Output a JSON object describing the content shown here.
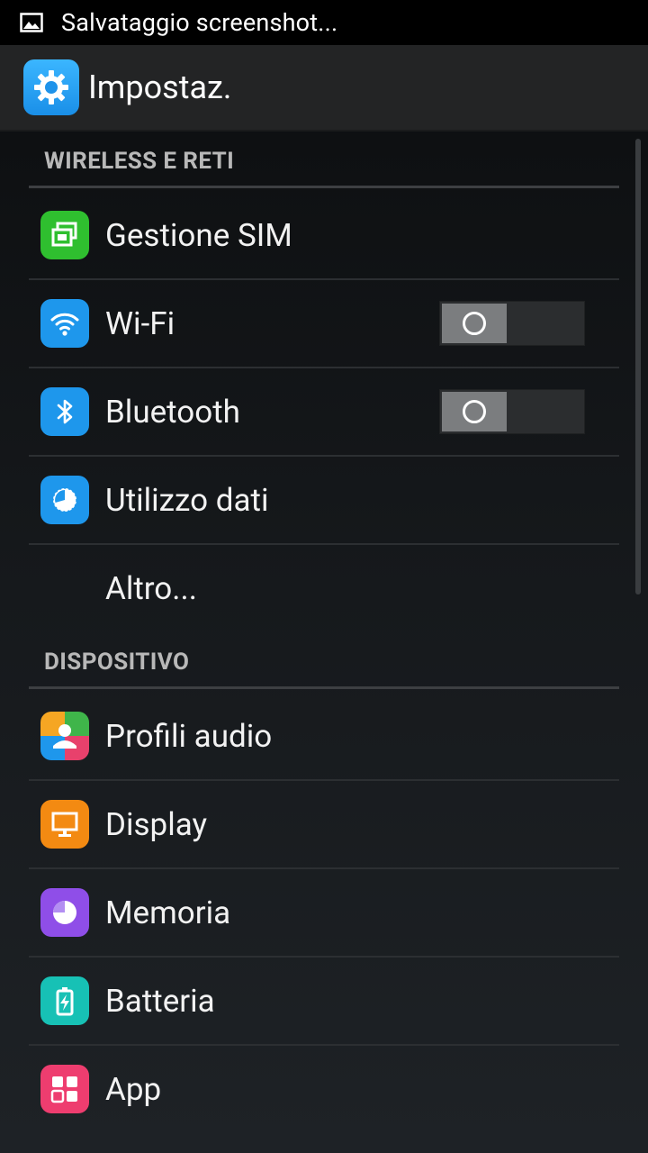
{
  "status_bar": {
    "notification_icon": "screenshot-image-icon",
    "text": "Salvataggio screenshot..."
  },
  "action_bar": {
    "app_icon": "settings-gear-icon",
    "title": "Impostaz."
  },
  "sections": [
    {
      "header": "WIRELESS E RETI",
      "items": [
        {
          "label": "Gestione SIM",
          "icon": "sim-card-icon",
          "icon_color": "#2fbf2f"
        },
        {
          "label": "Wi-Fi",
          "icon": "wifi-icon",
          "icon_color": "#1e97ec",
          "toggle": "off"
        },
        {
          "label": "Bluetooth",
          "icon": "bluetooth-icon",
          "icon_color": "#1e97ec",
          "toggle": "off"
        },
        {
          "label": "Utilizzo dati",
          "icon": "data-usage-icon",
          "icon_color": "#1e97ec"
        },
        {
          "label": "Altro..."
        }
      ]
    },
    {
      "header": "DISPOSITIVO",
      "items": [
        {
          "label": "Profili audio",
          "icon": "audio-profiles-icon",
          "icon_color": "#f5a623"
        },
        {
          "label": "Display",
          "icon": "display-icon",
          "icon_color": "#f38a12"
        },
        {
          "label": "Memoria",
          "icon": "memory-icon",
          "icon_color": "#8f4ee8"
        },
        {
          "label": "Batteria",
          "icon": "battery-icon",
          "icon_color": "#17c1b5"
        },
        {
          "label": "App",
          "icon": "apps-icon",
          "icon_color": "#ee3d6f"
        }
      ]
    }
  ]
}
